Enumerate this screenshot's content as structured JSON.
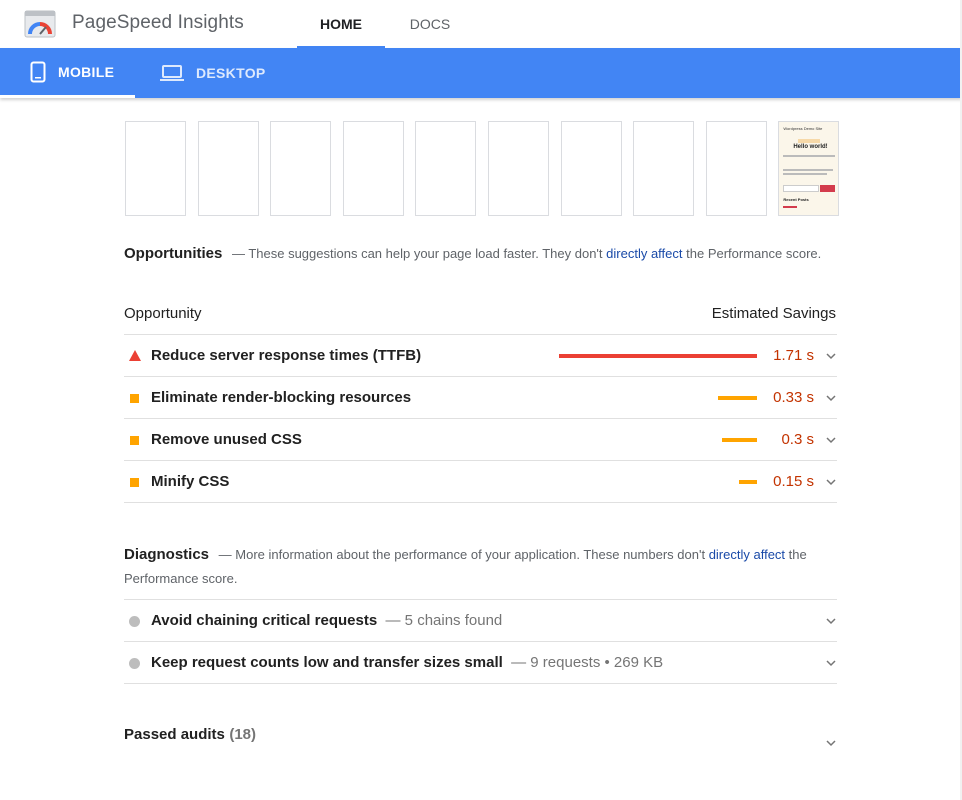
{
  "header": {
    "brand": "PageSpeed Insights",
    "nav": [
      {
        "label": "HOME"
      },
      {
        "label": "DOCS"
      }
    ],
    "accent_color": "#4285f4"
  },
  "device_tabs": [
    {
      "label": "MOBILE",
      "icon": "smartphone-icon"
    },
    {
      "label": "DESKTOP",
      "icon": "laptop-icon"
    }
  ],
  "filmstrip": {
    "frames": 10,
    "last_frame": {
      "site_title": "Wordpress Demo Site",
      "heading": "Hello world!",
      "section": "Recent Posts"
    }
  },
  "opportunities": {
    "title": "Opportunities",
    "desc_prefix": "— These suggestions can help your page load faster. They don't",
    "link": "directly affect",
    "desc_suffix": "the Performance score.",
    "col_left": "Opportunity",
    "col_right": "Estimated Savings",
    "items": [
      {
        "label": "Reduce server response times (TTFB)",
        "value": "1.71 s",
        "severity": "fail",
        "bar_color": "#eb4034"
      },
      {
        "label": "Eliminate render-blocking resources",
        "value": "0.33 s",
        "severity": "average",
        "bar_color": "#ffa400"
      },
      {
        "label": "Remove unused CSS",
        "value": "0.3 s",
        "severity": "average",
        "bar_color": "#ffa400"
      },
      {
        "label": "Minify CSS",
        "value": "0.15 s",
        "severity": "average",
        "bar_color": "#ffa400"
      }
    ]
  },
  "diagnostics": {
    "title": "Diagnostics",
    "desc_prefix": "— More information about the performance of your application. These numbers don't",
    "link": "directly affect",
    "desc_suffix": "the Performance score.",
    "items": [
      {
        "label": "Avoid chaining critical requests",
        "detail": "— 5 chains found"
      },
      {
        "label": "Keep request counts low and transfer sizes small",
        "detail": "— 9 requests • 269 KB"
      }
    ]
  },
  "passed": {
    "label": "Passed audits",
    "count": "(18)"
  }
}
